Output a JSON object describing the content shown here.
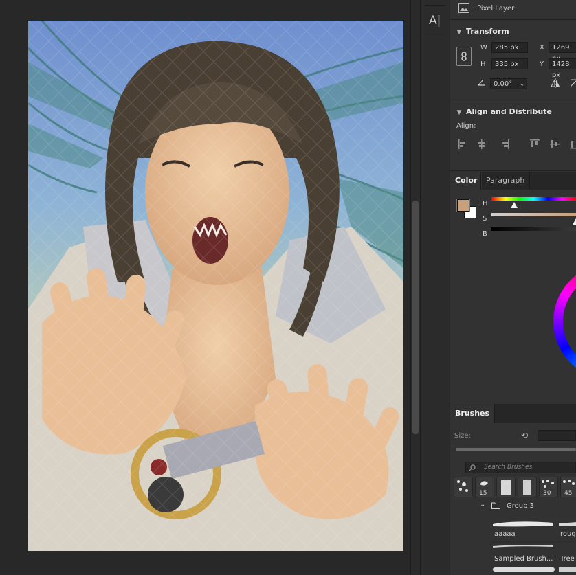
{
  "properties": {
    "layer_type": "Pixel Layer",
    "transform": {
      "title": "Transform",
      "w_label": "W",
      "w_value": "285 px",
      "h_label": "H",
      "h_value": "335 px",
      "x_label": "X",
      "x_value": "1269 px",
      "y_label": "Y",
      "y_value": "1428 px",
      "angle_value": "0.00°"
    },
    "align": {
      "title": "Align and Distribute",
      "align_label": "Align:"
    }
  },
  "color_panel": {
    "tabs": [
      "Color",
      "Paragraph"
    ],
    "active_tab": "Color",
    "foreground_color": "#c8a07c",
    "background_color": "#ffffff",
    "h_label": "H",
    "s_label": "S",
    "b_label": "B"
  },
  "brushes_panel": {
    "tab": "Brushes",
    "size_label": "Size:",
    "search_placeholder": "Search Brushes",
    "tip_sizes": [
      "15",
      "30",
      "45"
    ],
    "group_name": "Group 3",
    "brushes": [
      "aaaaa",
      "roug",
      "Sampled Brush...",
      "Tree"
    ]
  },
  "tools": {
    "type_tool_glyph": "A|"
  },
  "colors": {
    "panel_bg": "#323232",
    "app_bg": "#282828",
    "field_bg": "#262626"
  }
}
